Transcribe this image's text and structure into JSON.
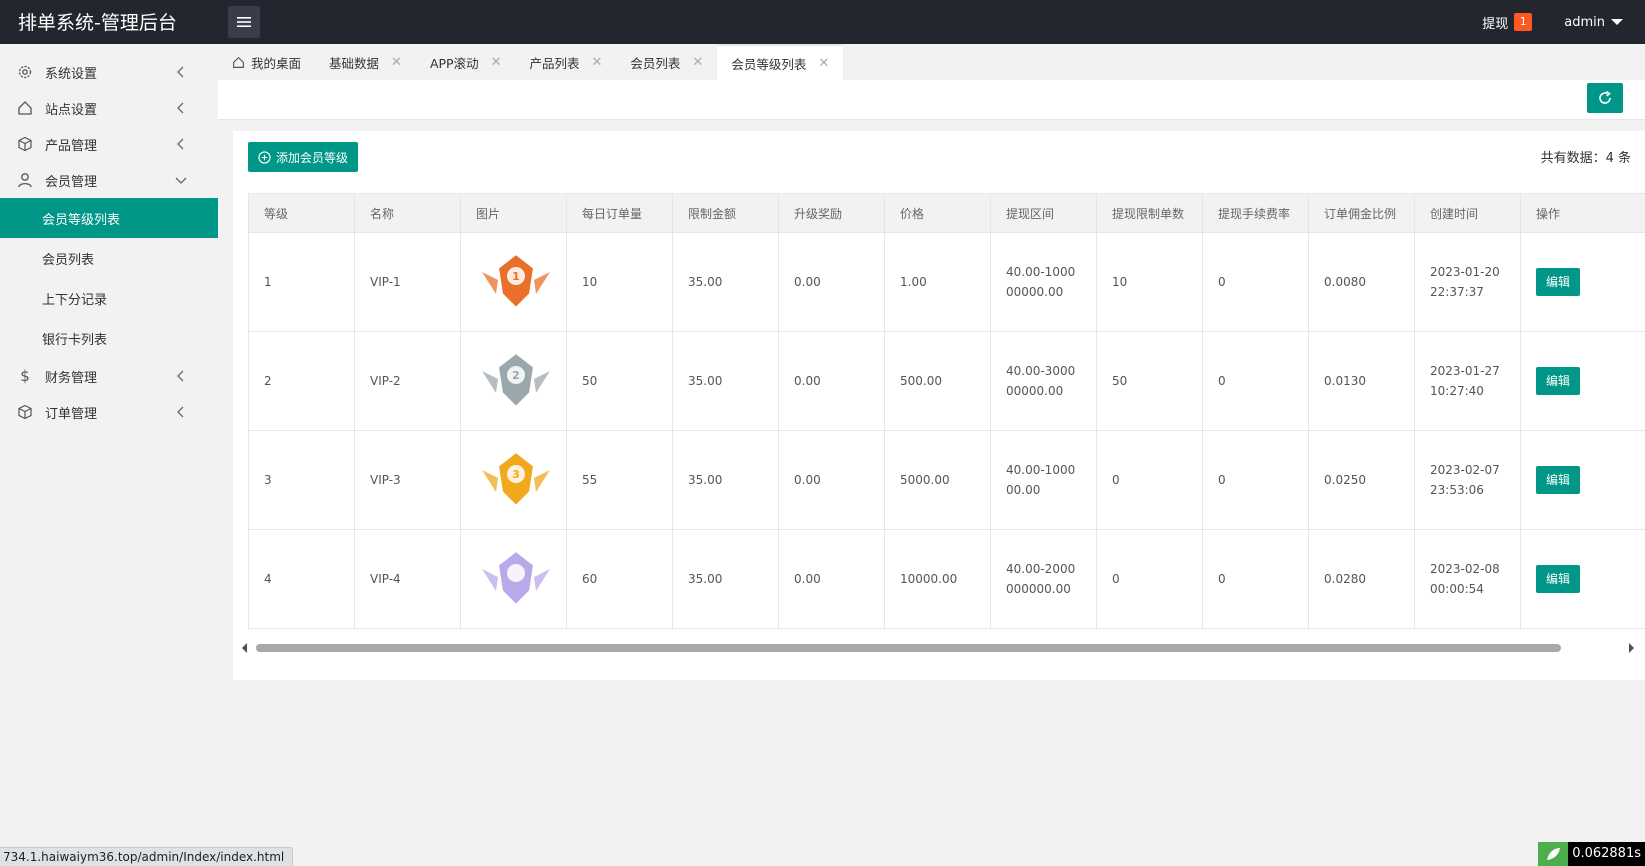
{
  "app": {
    "title": "排单系统-管理后台"
  },
  "header": {
    "withdraw_label": "提现",
    "withdraw_badge": "1",
    "user": "admin"
  },
  "sidebar": {
    "items": [
      {
        "label": "系统设置",
        "icon": "gear-icon"
      },
      {
        "label": "站点设置",
        "icon": "home-icon"
      },
      {
        "label": "产品管理",
        "icon": "cube-icon"
      },
      {
        "label": "会员管理",
        "icon": "user-icon"
      },
      {
        "label": "财务管理",
        "icon": "dollar-icon"
      },
      {
        "label": "订单管理",
        "icon": "cube-icon"
      }
    ],
    "member_sub": [
      {
        "label": "会员等级列表"
      },
      {
        "label": "会员列表"
      },
      {
        "label": "上下分记录"
      },
      {
        "label": "银行卡列表"
      }
    ]
  },
  "tabs": [
    {
      "label": "我的桌面"
    },
    {
      "label": "基础数据"
    },
    {
      "label": "APP滚动"
    },
    {
      "label": "产品列表"
    },
    {
      "label": "会员列表"
    },
    {
      "label": "会员等级列表"
    }
  ],
  "main": {
    "add_button": "添加会员等级",
    "count_text": "共有数据：4 条",
    "columns": [
      "等级",
      "名称",
      "图片",
      "每日订单量",
      "限制金额",
      "升级奖励",
      "价格",
      "提现区间",
      "提现限制单数",
      "提现手续费率",
      "订单佣金比例",
      "创建时间",
      "操作"
    ],
    "rows": [
      {
        "level": "1",
        "name": "VIP-1",
        "badge_color": "#e8702a",
        "badge_num": "1",
        "daily": "10",
        "limit": "35.00",
        "reward": "0.00",
        "price": "1.00",
        "range": "40.00-100000000.00",
        "limit_orders": "10",
        "fee": "0",
        "commission": "0.0080",
        "created": "2023-01-20 22:37:37",
        "action": "编辑"
      },
      {
        "level": "2",
        "name": "VIP-2",
        "badge_color": "#9aa7ad",
        "badge_num": "2",
        "daily": "50",
        "limit": "35.00",
        "reward": "0.00",
        "price": "500.00",
        "range": "40.00-300000000.00",
        "limit_orders": "50",
        "fee": "0",
        "commission": "0.0130",
        "created": "2023-01-27 10:27:40",
        "action": "编辑"
      },
      {
        "level": "3",
        "name": "VIP-3",
        "badge_color": "#f0a81c",
        "badge_num": "3",
        "daily": "55",
        "limit": "35.00",
        "reward": "0.00",
        "price": "5000.00",
        "range": "40.00-100000.00",
        "limit_orders": "0",
        "fee": "0",
        "commission": "0.0250",
        "created": "2023-02-07 23:53:06",
        "action": "编辑"
      },
      {
        "level": "4",
        "name": "VIP-4",
        "badge_color": "#b9a9e8",
        "badge_num": "",
        "daily": "60",
        "limit": "35.00",
        "reward": "0.00",
        "price": "10000.00",
        "range": "40.00-2000000000.00",
        "limit_orders": "0",
        "fee": "0",
        "commission": "0.0280",
        "created": "2023-02-08 00:00:54",
        "action": "编辑"
      }
    ]
  },
  "statusbar": {
    "url": "734.1.haiwaiym36.top/admin/Index/index.html",
    "timer": "0.062881s"
  }
}
